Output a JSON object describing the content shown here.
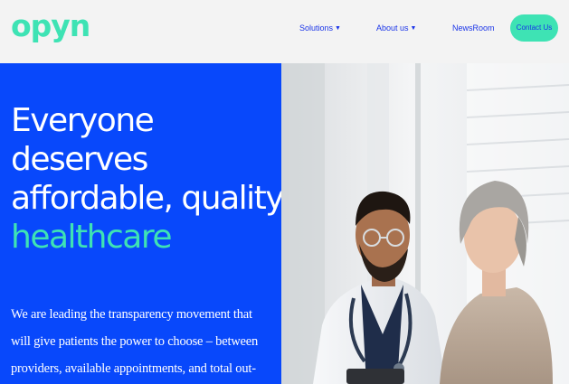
{
  "brand": {
    "logo_text": "opyn",
    "primary_blue": "#0848fb",
    "accent_green": "#3ee3b4",
    "nav_blue": "#1a34e8"
  },
  "nav": {
    "items": [
      {
        "label": "Solutions",
        "has_dropdown": true
      },
      {
        "label": "About us",
        "has_dropdown": true
      },
      {
        "label": "NewsRoom",
        "has_dropdown": false
      }
    ],
    "cta_label": "Contact Us",
    "dropdown_icon": "caret-down-icon"
  },
  "hero": {
    "headline_lines": [
      "Everyone",
      "deserves",
      "affordable, quality"
    ],
    "headline_accent": "healthcare",
    "body_lines": [
      "We are leading the transparency movement that",
      "will give patients the power to choose – between",
      "providers, available appointments, and total out-"
    ],
    "image_subject": "doctor-and-patient-photo"
  }
}
